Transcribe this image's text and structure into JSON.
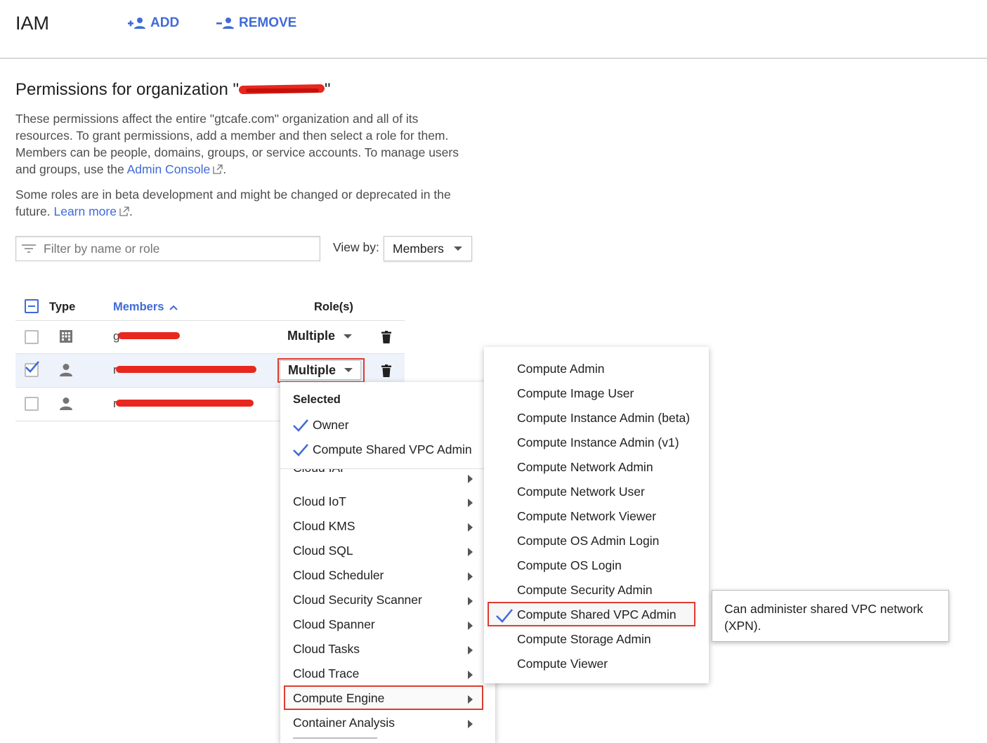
{
  "header": {
    "title": "IAM",
    "add_label": "ADD",
    "remove_label": "REMOVE"
  },
  "section": {
    "title_prefix": "Permissions for organization \"",
    "title_suffix": "\"",
    "desc_line1": "These permissions affect the entire \"gtcafe.com\" organization and all of its",
    "desc_line2": "resources. To grant permissions, add a member and then select a role for them.",
    "desc_line3": "Members can be people, domains, groups, or service accounts. To manage users",
    "desc_line4_prefix": "and groups, use the ",
    "admin_console_link": "Admin Console",
    "desc_line4_suffix": ".",
    "beta_line1": "Some roles are in beta development and might be changed or deprecated in the",
    "beta_line2_prefix": "future. ",
    "learn_more_link": "Learn more",
    "beta_line2_suffix": "."
  },
  "filter": {
    "placeholder": "Filter by name or role",
    "view_by_label": "View by:",
    "view_by_value": "Members"
  },
  "table": {
    "col_type": "Type",
    "col_members": "Members",
    "col_roles": "Role(s)",
    "rows": [
      {
        "type_icon": "domain-icon",
        "member": "g",
        "roles": "Multiple",
        "checked": false
      },
      {
        "type_icon": "person-icon",
        "member": "r",
        "roles": "Multiple",
        "checked": true
      },
      {
        "type_icon": "person-icon",
        "member": "r",
        "roles": "",
        "checked": false
      }
    ]
  },
  "role_menu": {
    "selected_header": "Selected",
    "selected": [
      "Owner",
      "Compute Shared VPC Admin"
    ],
    "categories": [
      "Cloud IoT",
      "Cloud KMS",
      "Cloud SQL",
      "Cloud Scheduler",
      "Cloud Security Scanner",
      "Cloud Spanner",
      "Cloud Tasks",
      "Cloud Trace",
      "Compute Engine",
      "Container Analysis"
    ],
    "highlighted_category": "Compute Engine"
  },
  "compute_submenu": {
    "items": [
      "Compute Admin",
      "Compute Image User",
      "Compute Instance Admin (beta)",
      "Compute Instance Admin (v1)",
      "Compute Network Admin",
      "Compute Network User",
      "Compute Network Viewer",
      "Compute OS Admin Login",
      "Compute OS Login",
      "Compute Security Admin",
      "Compute Shared VPC Admin",
      "Compute Storage Admin",
      "Compute Viewer"
    ],
    "checked_item": "Compute Shared VPC Admin"
  },
  "tooltip": {
    "text": "Can administer shared VPC network (XPN)."
  },
  "colors": {
    "accent": "#3f6ad8",
    "highlight_border": "#e03b2f",
    "redaction": "#e8271e"
  }
}
